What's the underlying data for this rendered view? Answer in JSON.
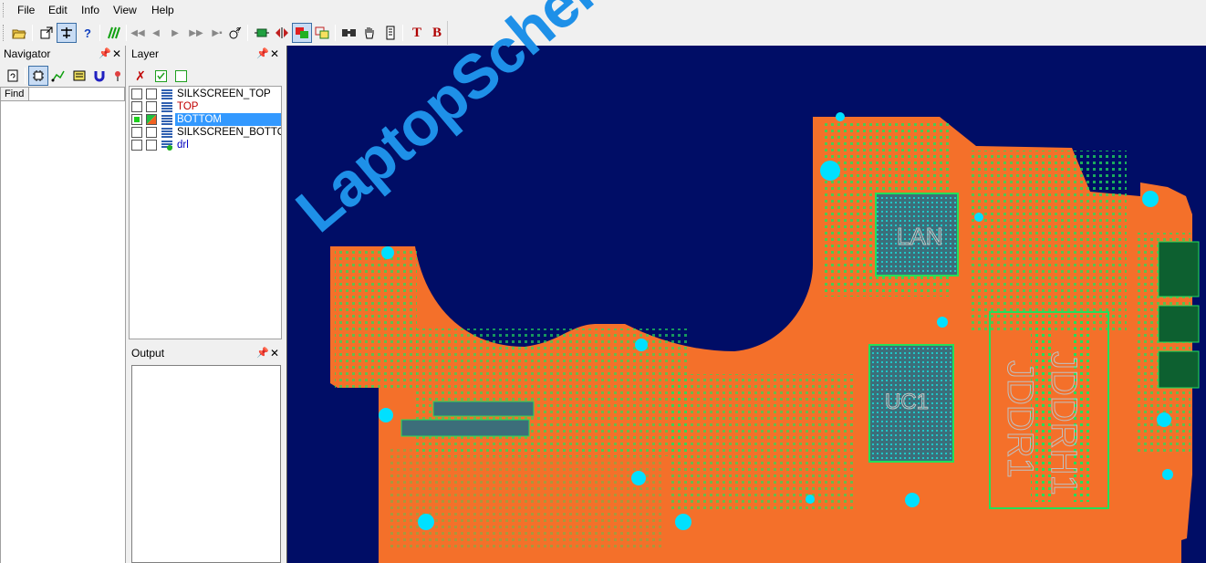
{
  "menu": [
    {
      "label": "File",
      "accel": "F"
    },
    {
      "label": "Edit",
      "accel": "E"
    },
    {
      "label": "Info",
      "accel": "I"
    },
    {
      "label": "View",
      "accel": "V"
    },
    {
      "label": "Help",
      "accel": "H"
    }
  ],
  "toolbar": {
    "icons": [
      "open-icon",
      "window-icon",
      "bridge-icon",
      "help-icon",
      "nets-icon",
      "first-icon",
      "prev-icon",
      "play-icon",
      "next-icon",
      "last-icon",
      "search-icon",
      "fit-icon",
      "flip-icon",
      "layer-color-icon",
      "overlay-icon",
      "find-icon",
      "hand-icon",
      "panel-icon",
      "text-icon",
      "bold-icon"
    ],
    "help_glyph": "?",
    "text_glyph": "T",
    "bold_glyph": "B"
  },
  "navigator": {
    "title": "Navigator",
    "find_label": "Find",
    "find_value": ""
  },
  "layer": {
    "title": "Layer",
    "items": [
      {
        "name": "SILKSCREEN_TOP",
        "color": "#000000",
        "visible": false,
        "selected": false
      },
      {
        "name": "TOP",
        "color": "#c00000",
        "visible": false,
        "selected": false
      },
      {
        "name": "BOTTOM",
        "color": "#ffffff",
        "visible": true,
        "selected": true
      },
      {
        "name": "SILKSCREEN_BOTTOM",
        "color": "#000000",
        "visible": false,
        "selected": false
      },
      {
        "name": "drl",
        "color": "#0000c0",
        "visible": false,
        "selected": false
      }
    ]
  },
  "output": {
    "title": "Output"
  },
  "canvas": {
    "background": "#000d66",
    "board_color": "#f4702a",
    "component_color": "#22e05a",
    "labels": [
      "LAN",
      "UC1",
      "JDDR1",
      "JDDRH1"
    ],
    "watermark": "LaptopSchematic.com"
  },
  "colors": {
    "accent": "#3399ff",
    "selection": "#3399ff"
  }
}
